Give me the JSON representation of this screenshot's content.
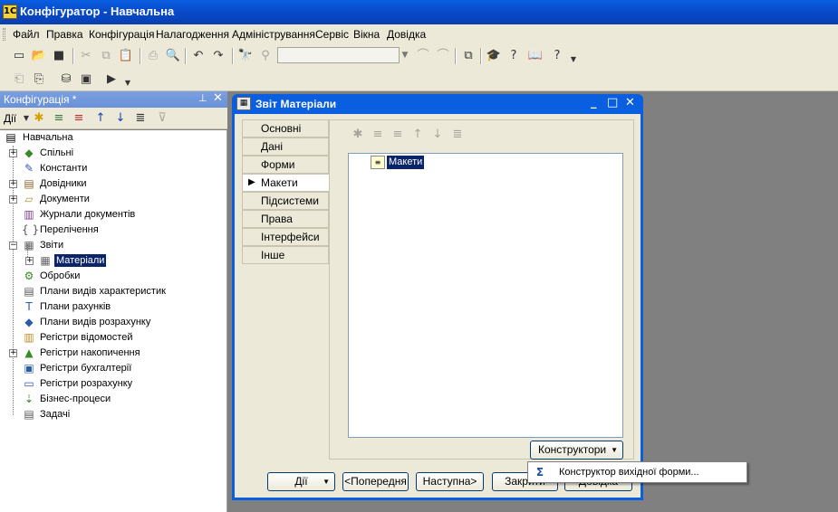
{
  "window": {
    "title": "Конфігуратор - Навчальна",
    "app_icon": "1C"
  },
  "menu": {
    "items": [
      "Файл",
      "Правка",
      "Конфігурація",
      "Налагодження",
      "Адміністрування",
      "Сервіс",
      "Вікна",
      "Довідка"
    ]
  },
  "toolbar": {
    "search_value": ""
  },
  "left_panel": {
    "title": "Конфігурація *",
    "pin": "⊥",
    "close": "✕",
    "actions_label": "Дії",
    "tree": [
      {
        "label": "Навчальна",
        "icon": "config-root-icon"
      },
      {
        "label": "Спільні",
        "icon": "common-icon"
      },
      {
        "label": "Константи",
        "icon": "constants-icon"
      },
      {
        "label": "Довідники",
        "icon": "catalogs-icon"
      },
      {
        "label": "Документи",
        "icon": "documents-icon"
      },
      {
        "label": "Журнали документів",
        "icon": "journals-icon"
      },
      {
        "label": "Перелічення",
        "icon": "enums-icon"
      },
      {
        "label": "Звіти",
        "icon": "reports-icon"
      },
      {
        "label": "Матеріали",
        "icon": "report-item-icon"
      },
      {
        "label": "Обробки",
        "icon": "processings-icon"
      },
      {
        "label": "Плани видів характеристик",
        "icon": "chart-char-icon"
      },
      {
        "label": "Плани рахунків",
        "icon": "chart-accounts-icon"
      },
      {
        "label": "Плани видів розрахунку",
        "icon": "chart-calc-icon"
      },
      {
        "label": "Регістри відомостей",
        "icon": "info-reg-icon"
      },
      {
        "label": "Регістри накопичення",
        "icon": "accum-reg-icon"
      },
      {
        "label": "Регістри бухгалтерії",
        "icon": "acc-reg-icon"
      },
      {
        "label": "Регістри розрахунку",
        "icon": "calc-reg-icon"
      },
      {
        "label": "Бізнес-процеси",
        "icon": "bp-icon"
      },
      {
        "label": "Задачі",
        "icon": "tasks-icon"
      }
    ]
  },
  "dialog": {
    "title": "Звіт Матеріали",
    "tabs": [
      "Основні",
      "Дані",
      "Форми",
      "Макети",
      "Підсистеми",
      "Права",
      "Інтерфейси",
      "Інше"
    ],
    "active_tab": "Макети",
    "list_item": "Макети",
    "constructor_button": "Конструктори",
    "buttons": {
      "actions": "Дії",
      "prev": "<Попередня",
      "next": "Наступна>",
      "close": "Закрити",
      "help": "Довідка"
    }
  },
  "popup": {
    "item": "Конструктор вихідної форми..."
  }
}
